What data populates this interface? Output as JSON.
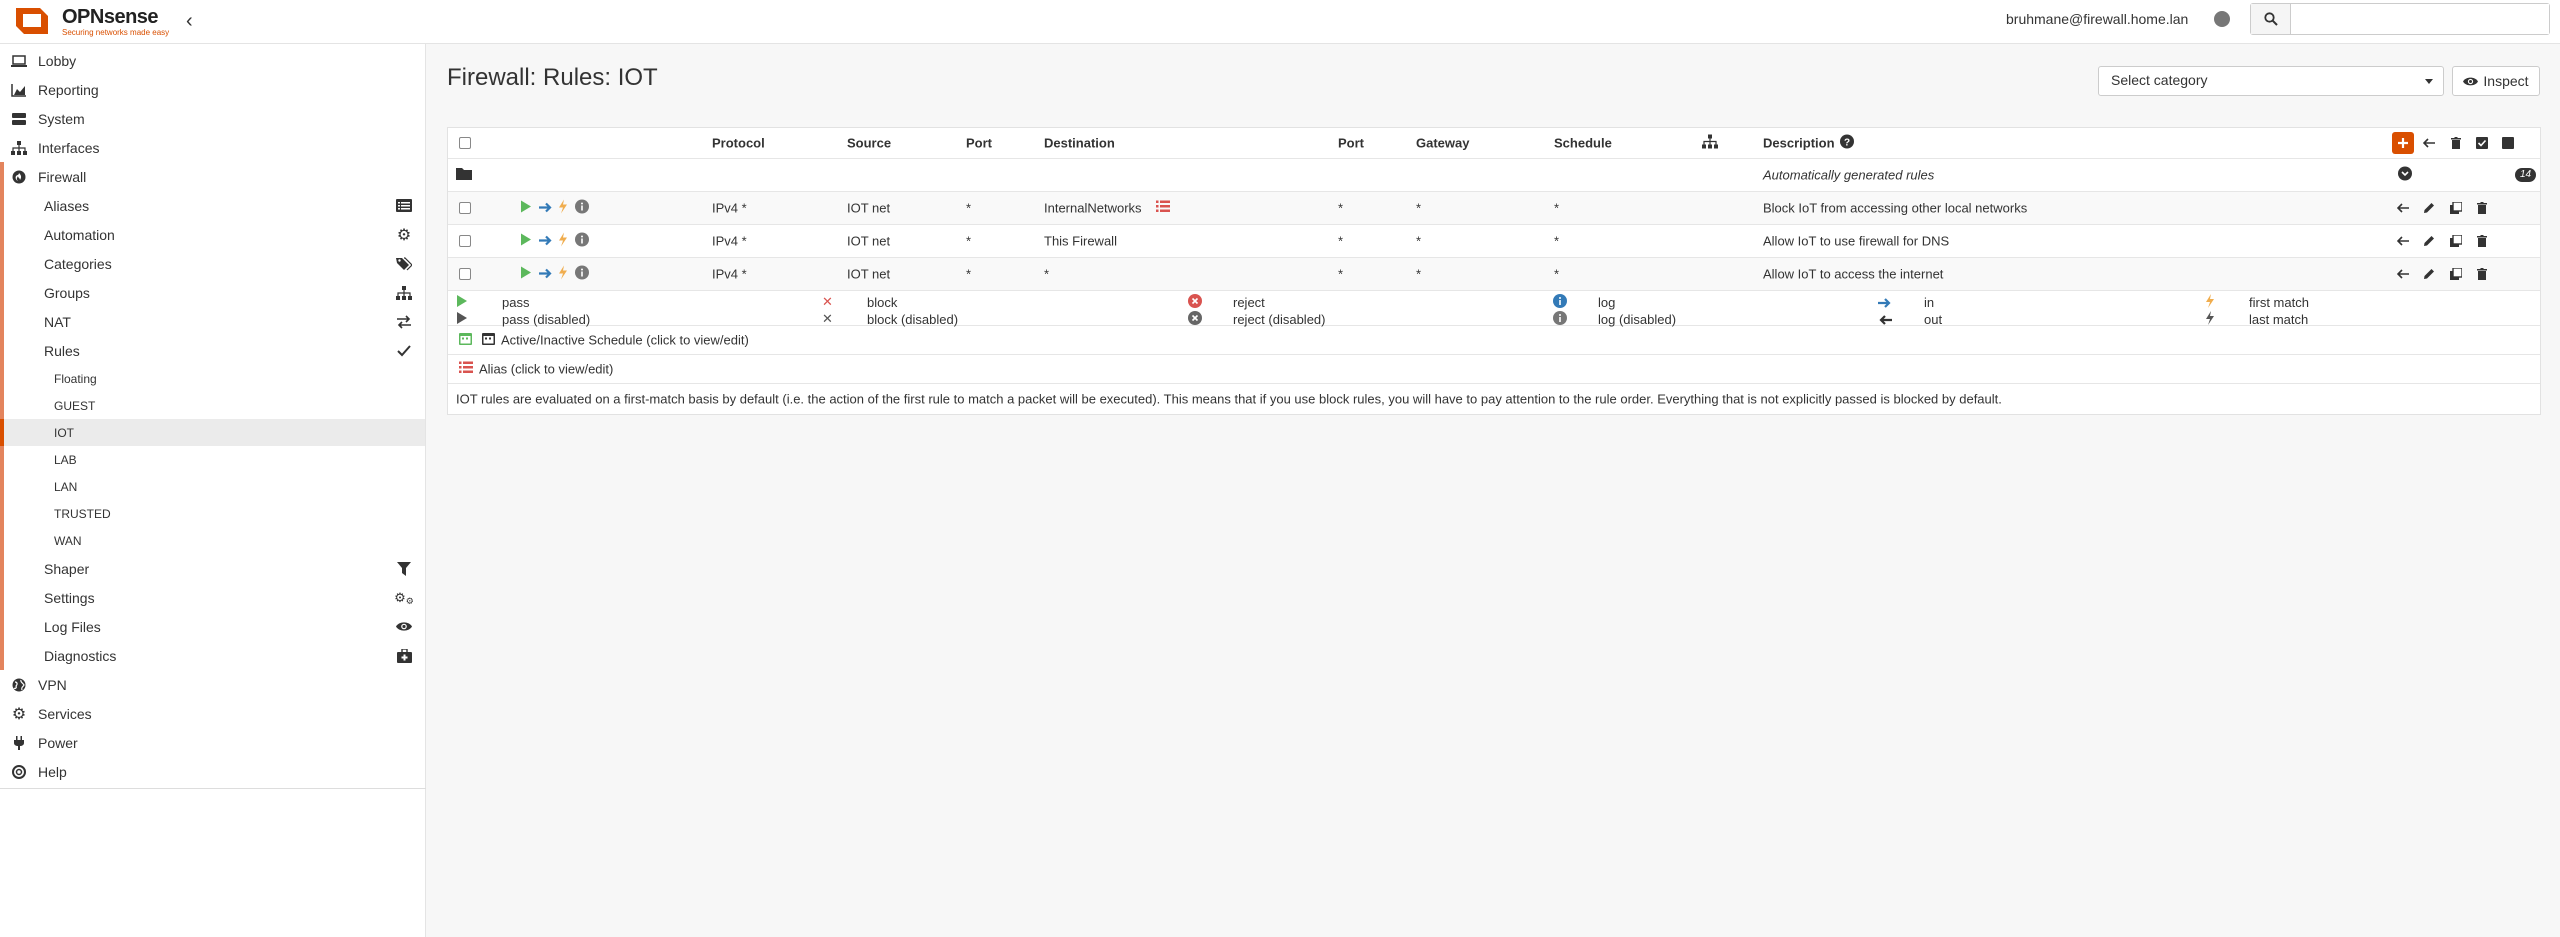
{
  "brand": {
    "name": "OPNsense",
    "tagline": "Securing networks made easy",
    "color": "#d94f00"
  },
  "topbar": {
    "user": "bruhmane@firewall.home.lan",
    "search_placeholder": ""
  },
  "sidebar": {
    "items": [
      {
        "label": "Lobby",
        "icon": "laptop-icon"
      },
      {
        "label": "Reporting",
        "icon": "area-chart-icon"
      },
      {
        "label": "System",
        "icon": "server-icon"
      },
      {
        "label": "Interfaces",
        "icon": "sitemap-icon"
      },
      {
        "label": "Firewall",
        "icon": "fire-icon"
      },
      {
        "label": "VPN",
        "icon": "globe-icon"
      },
      {
        "label": "Services",
        "icon": "cog-icon"
      },
      {
        "label": "Power",
        "icon": "plug-icon"
      },
      {
        "label": "Help",
        "icon": "support-icon"
      }
    ],
    "firewall": [
      {
        "label": "Aliases",
        "icon": "list-alt-icon"
      },
      {
        "label": "Automation",
        "icon": "cog-icon"
      },
      {
        "label": "Categories",
        "icon": "tags-icon"
      },
      {
        "label": "Groups",
        "icon": "sitemap-icon"
      },
      {
        "label": "NAT",
        "icon": "exchange-icon"
      },
      {
        "label": "Rules",
        "icon": "check-icon"
      },
      {
        "label": "Shaper",
        "icon": "filter-icon"
      },
      {
        "label": "Settings",
        "icon": "cogs-icon"
      },
      {
        "label": "Log Files",
        "icon": "eye-icon"
      },
      {
        "label": "Diagnostics",
        "icon": "medkit-icon"
      }
    ],
    "rules": [
      "Floating",
      "GUEST",
      "IOT",
      "LAB",
      "LAN",
      "TRUSTED",
      "WAN"
    ],
    "active_rule": "IOT"
  },
  "page": {
    "title": "Firewall: Rules: IOT",
    "category_placeholder": "Select category",
    "inspect_label": "Inspect"
  },
  "grid": {
    "columns": {
      "protocol": "Protocol",
      "source": "Source",
      "port": "Port",
      "destination": "Destination",
      "dport": "Port",
      "gateway": "Gateway",
      "schedule": "Schedule",
      "description": "Description"
    },
    "auto_label": "Automatically generated rules",
    "auto_count": "14",
    "rows": [
      {
        "protocol": "IPv4 *",
        "source": "IOT net",
        "port": "*",
        "destination": "InternalNetworks",
        "dport": "*",
        "gateway": "*",
        "schedule": "*",
        "description": "Block IoT from accessing other local networks"
      },
      {
        "protocol": "IPv4 *",
        "source": "IOT net",
        "port": "*",
        "destination": "This Firewall",
        "dport": "*",
        "gateway": "*",
        "schedule": "*",
        "description": "Allow IoT to use firewall for DNS"
      },
      {
        "protocol": "IPv4 *",
        "source": "IOT net",
        "port": "*",
        "destination": "*",
        "dport": "*",
        "gateway": "*",
        "schedule": "*",
        "description": "Allow IoT to access the internet"
      }
    ]
  },
  "legend": {
    "pass": "pass",
    "pass_disabled": "pass (disabled)",
    "block": "block",
    "block_disabled": "block (disabled)",
    "reject": "reject",
    "reject_disabled": "reject (disabled)",
    "log": "log",
    "log_disabled": "log (disabled)",
    "in": "in",
    "out": "out",
    "first_match": "first match",
    "last_match": "last match",
    "schedule": "Active/Inactive Schedule (click to view/edit)",
    "alias": "Alias (click to view/edit)",
    "note": "IOT rules are evaluated on a first-match basis by default (i.e. the action of the first rule to match a packet will be executed). This means that if you use block rules, you will have to pay attention to the rule order. Everything that is not explicitly passed is blocked by default."
  },
  "colors": {
    "pass": "#5cb85c",
    "block": "#d9534f",
    "info": "#337ab7",
    "lightning": "#f0ad4e"
  }
}
